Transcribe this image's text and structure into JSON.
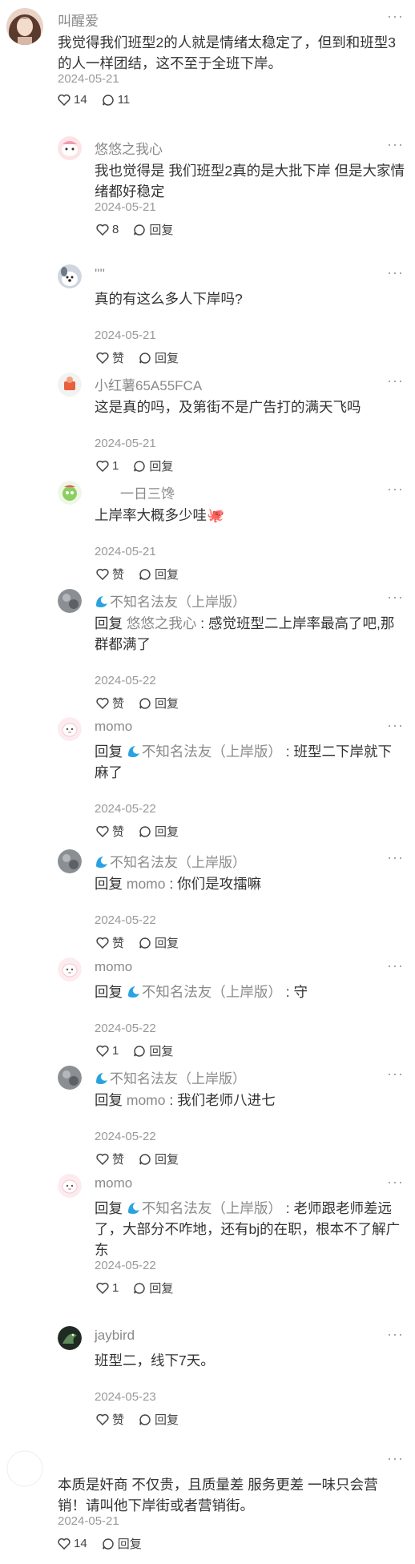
{
  "more_label": "···",
  "comments": [
    {
      "user": "叫醒爱",
      "text": "我觉得我们班型2的人就是情绪太稳定了，但到和班型3的人一样团结，这不至于全班下岸。",
      "date": "2024-05-21",
      "likes": "14",
      "replies_count": "11",
      "avatar_icon": "girl-portrait-avatar",
      "replies": [
        {
          "user": "悠悠之我心",
          "text": "我也觉得是 我们班型2真的是大批下岸 但是大家情绪都好稳定",
          "date": "2024-05-21",
          "like": "8",
          "reply": "回复",
          "avatar_icon": "cartoon-avatar"
        },
        {
          "user": "''''",
          "text": "真的有这么多人下岸吗?",
          "date": "2024-05-21",
          "like": "赞",
          "reply": "回复",
          "avatar_icon": "dog-avatar"
        },
        {
          "user": "小红薯65A55FCA",
          "text": "这是真的吗，及第街不是广告打的满天飞吗",
          "date": "2024-05-21",
          "like": "1",
          "reply": "回复",
          "avatar_icon": "default-avatar"
        },
        {
          "user": "一日三馋",
          "text": "上岸率大概多少哇",
          "emoji": "🐙",
          "date": "2024-05-21",
          "like": "赞",
          "reply": "回复",
          "avatar_icon": "cartoon-green-avatar"
        },
        {
          "user": "不知名法友（上岸版）",
          "prefix": "回复",
          "target": "悠悠之我心",
          "text": " : 感觉班型二上岸率最高了吧,那群都满了",
          "date": "2024-05-22",
          "like": "赞",
          "reply": "回复",
          "avatar_icon": "gray-avatar"
        },
        {
          "user": "momo",
          "prefix": "回复",
          "target": "不知名法友（上岸版）",
          "target_wave": true,
          "text": " : 班型二下岸就下麻了",
          "date": "2024-05-22",
          "like": "赞",
          "reply": "回复",
          "avatar_icon": "pink-avatar"
        },
        {
          "user": "不知名法友（上岸版）",
          "prefix": "回复",
          "target": "momo",
          "text": " : 你们是攻擂嘛",
          "date": "2024-05-22",
          "like": "赞",
          "reply": "回复",
          "avatar_icon": "gray-avatar"
        },
        {
          "user": "momo",
          "prefix": "回复",
          "target": "不知名法友（上岸版）",
          "target_wave": true,
          "text": " : 守",
          "date": "2024-05-22",
          "like": "1",
          "reply": "回复",
          "avatar_icon": "pink-avatar"
        },
        {
          "user": "不知名法友（上岸版）",
          "prefix": "回复",
          "target": "momo",
          "text": " : 我们老师八进七",
          "date": "2024-05-22",
          "like": "赞",
          "reply": "回复",
          "avatar_icon": "gray-avatar"
        },
        {
          "user": "momo",
          "prefix": "回复",
          "target": "不知名法友（上岸版）",
          "target_wave": true,
          "text": " : 老师跟老师差远了，大部分不咋地，还有bj的在职，根本不了解广东",
          "date": "2024-05-22",
          "like": "1",
          "reply": "回复",
          "avatar_icon": "pink-avatar"
        },
        {
          "user": "jaybird",
          "text": "班型二，线下7天。",
          "date": "2024-05-23",
          "like": "赞",
          "reply": "回复",
          "avatar_icon": "bird-avatar"
        }
      ]
    },
    {
      "user": "",
      "text": "本质是奸商 不仅贵，且质量差 服务更差 一味只会营销！请叫他下岸街或者营销街。",
      "date": "2024-05-21",
      "likes": "14",
      "reply_label": "回复",
      "avatar_icon": "blank-avatar"
    }
  ]
}
